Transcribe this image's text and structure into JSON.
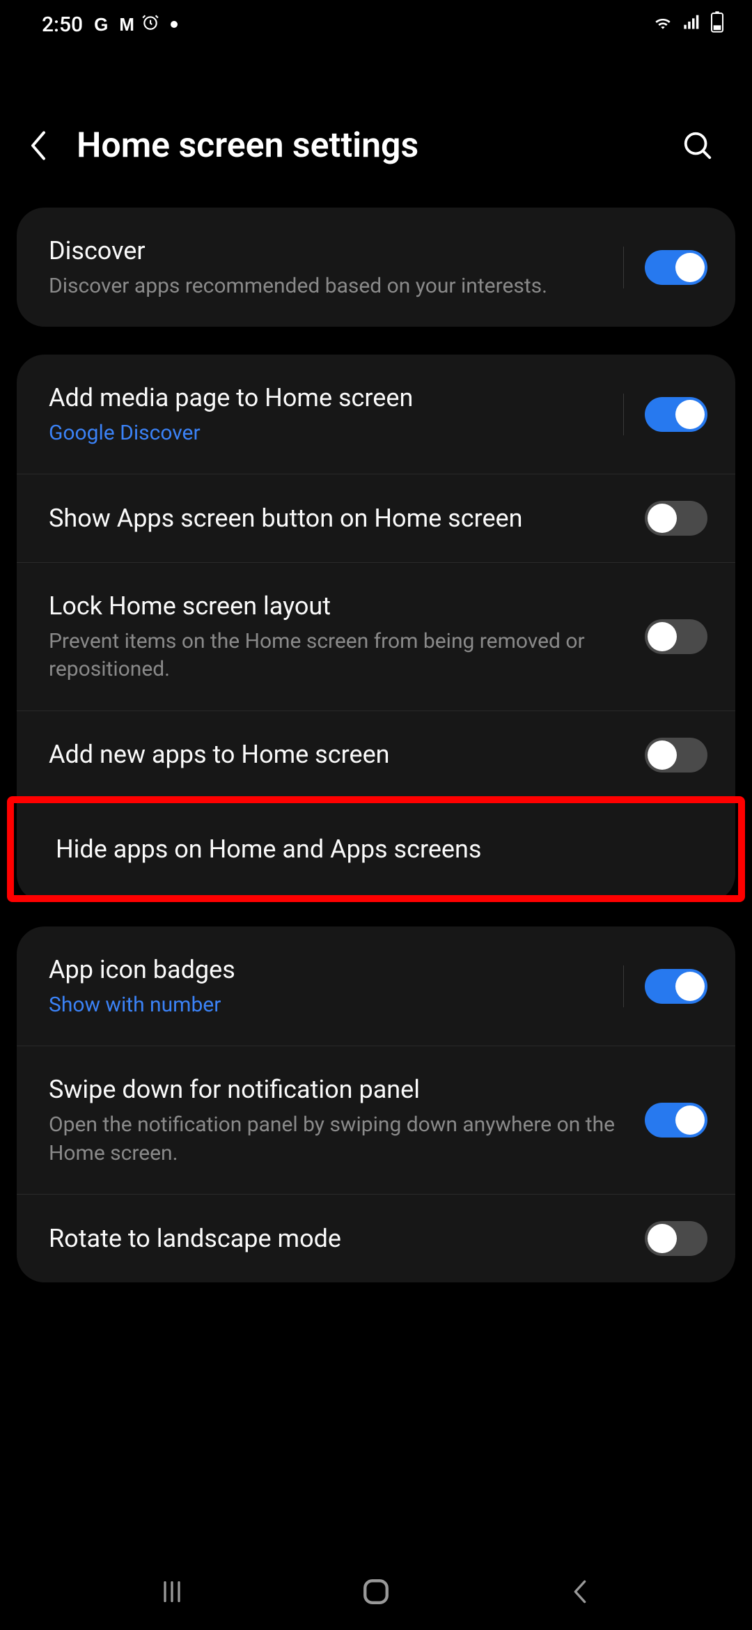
{
  "statusBar": {
    "time": "2:50",
    "leftIcons": [
      "G",
      "M",
      "alarm",
      "dot"
    ],
    "rightIcons": [
      "wifi",
      "signal",
      "battery"
    ]
  },
  "header": {
    "title": "Home screen settings"
  },
  "groups": [
    {
      "items": [
        {
          "title": "Discover",
          "subtitle": "Discover apps recommended based on your interests.",
          "subtitleLink": false,
          "hasToggle": true,
          "toggleOn": true,
          "hasDivider": true,
          "highlighted": false
        }
      ]
    },
    {
      "items": [
        {
          "title": "Add media page to Home screen",
          "subtitle": "Google Discover",
          "subtitleLink": true,
          "hasToggle": true,
          "toggleOn": true,
          "hasDivider": true,
          "highlighted": false
        },
        {
          "title": "Show Apps screen button on Home screen",
          "subtitle": "",
          "subtitleLink": false,
          "hasToggle": true,
          "toggleOn": false,
          "hasDivider": false,
          "highlighted": false
        },
        {
          "title": "Lock Home screen layout",
          "subtitle": "Prevent items on the Home screen from being removed or repositioned.",
          "subtitleLink": false,
          "hasToggle": true,
          "toggleOn": false,
          "hasDivider": false,
          "highlighted": false
        },
        {
          "title": "Add new apps to Home screen",
          "subtitle": "",
          "subtitleLink": false,
          "hasToggle": true,
          "toggleOn": false,
          "hasDivider": false,
          "highlighted": false
        },
        {
          "title": "Hide apps on Home and Apps screens",
          "subtitle": "",
          "subtitleLink": false,
          "hasToggle": false,
          "toggleOn": false,
          "hasDivider": false,
          "highlighted": true
        }
      ]
    },
    {
      "items": [
        {
          "title": "App icon badges",
          "subtitle": "Show with number",
          "subtitleLink": true,
          "hasToggle": true,
          "toggleOn": true,
          "hasDivider": true,
          "highlighted": false
        },
        {
          "title": "Swipe down for notification panel",
          "subtitle": "Open the notification panel by swiping down anywhere on the Home screen.",
          "subtitleLink": false,
          "hasToggle": true,
          "toggleOn": true,
          "hasDivider": false,
          "highlighted": false
        },
        {
          "title": "Rotate to landscape mode",
          "subtitle": "",
          "subtitleLink": false,
          "hasToggle": true,
          "toggleOn": false,
          "hasDivider": false,
          "highlighted": false
        }
      ]
    }
  ]
}
